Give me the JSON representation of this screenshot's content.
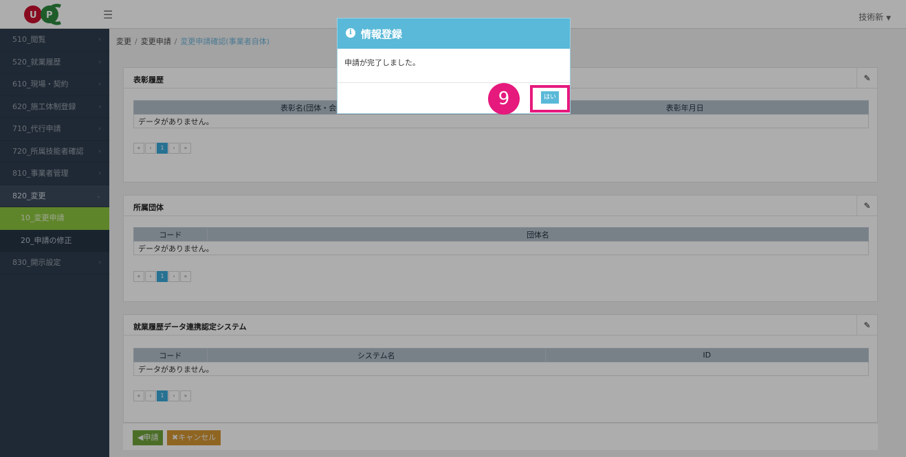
{
  "header": {
    "logo_text": "UPC",
    "menu_icon": "hamburger-icon",
    "user_name": "技術新",
    "user_caret": "▼"
  },
  "sidebar": {
    "items": [
      {
        "label": "510_閲覧",
        "arrow": "‹"
      },
      {
        "label": "520_就業履歴",
        "arrow": "‹"
      },
      {
        "label": "610_現場・契約",
        "arrow": "‹"
      },
      {
        "label": "620_施工体制登録",
        "arrow": "‹"
      },
      {
        "label": "710_代行申請",
        "arrow": "‹"
      },
      {
        "label": "720_所属技能者確認",
        "arrow": "‹"
      },
      {
        "label": "810_事業者管理",
        "arrow": "‹"
      },
      {
        "label": "820_変更",
        "arrow": "⌄"
      }
    ],
    "subitems": [
      {
        "label": "10_変更申請"
      },
      {
        "label": "20_申請の修正"
      }
    ],
    "last_item": {
      "label": "830_開示設定",
      "arrow": "‹"
    }
  },
  "breadcrumb": {
    "part1": "変更",
    "part2": "変更申請",
    "current": "変更申請確認(事業者自体)",
    "sep": "/"
  },
  "panels": {
    "awards": {
      "title": "表彰履歴",
      "col1": "表彰名(団体・会社名)",
      "col2": "表彰年月日",
      "empty": "データがありません。"
    },
    "groups": {
      "title": "所属団体",
      "col1": "コード",
      "col2": "団体名",
      "empty": "データがありません。"
    },
    "systems": {
      "title": "就業履歴データ連携認定システム",
      "col1": "コード",
      "col2": "システム名",
      "col3": "ID",
      "empty": "データがありません。"
    }
  },
  "pager": {
    "first": "«",
    "prev": "‹",
    "page": "1",
    "next": "›",
    "last": "»"
  },
  "edit_icon": "✎",
  "actions": {
    "submit_label": "◀申請",
    "cancel_label": "✖キャンセル"
  },
  "modal": {
    "icon": "i",
    "title": "情報登録",
    "message": "申請が完了しました。",
    "ok_label": "はい"
  },
  "callout": {
    "step_number": "9"
  },
  "colors": {
    "sidebar_bg": "#2e3d4f",
    "active_sub": "#8cc43f",
    "modal_head": "#5ab9d8",
    "callout": "#e6197d",
    "submit": "#6fa33a",
    "cancel": "#d39533"
  }
}
